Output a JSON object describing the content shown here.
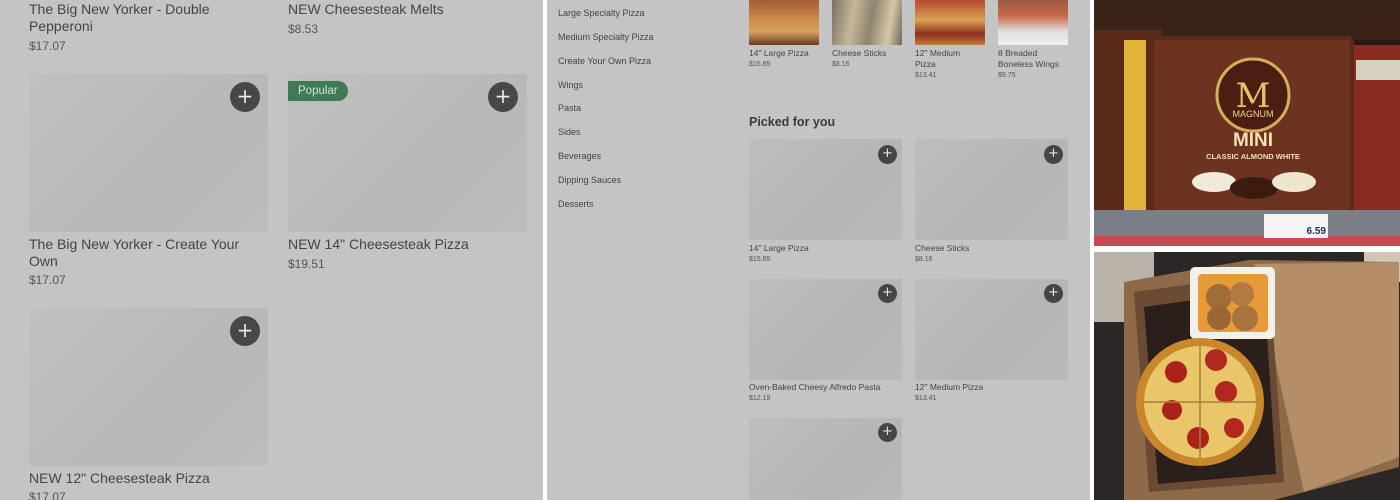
{
  "menu_left": {
    "items": [
      {
        "name": "The Big New Yorker - Double Pepperoni",
        "price": "$17.07"
      },
      {
        "name": "NEW Cheesesteak Melts",
        "price": "$8.53"
      },
      {
        "name": "The Big New Yorker - Create Your Own",
        "price": "$17.07"
      },
      {
        "name": "NEW 14\" Cheesesteak Pizza",
        "price": "$19.51",
        "badge": "Popular"
      },
      {
        "name": "NEW 12\" Cheesesteak Pizza",
        "price": "$17.07"
      }
    ],
    "add_glyph": "+"
  },
  "menu_right": {
    "categories": [
      "Large Specialty Pizza",
      "Medium Specialty Pizza",
      "Create Your Own Pizza",
      "Wings",
      "Pasta",
      "Sides",
      "Beverages",
      "Dipping Sauces",
      "Desserts"
    ],
    "top_items": [
      {
        "name": "14\" Large Pizza",
        "price": "$15.85"
      },
      {
        "name": "Cheese Sticks",
        "price": "$8.16"
      },
      {
        "name": "12\" Medium Pizza",
        "price": "$13.41"
      },
      {
        "name": "8 Breaded Boneless Wings",
        "price": "$9.75"
      }
    ],
    "section_title": "Picked for you",
    "picked": [
      {
        "name": "14\" Large Pizza",
        "price": "$15.85"
      },
      {
        "name": "Cheese Sticks",
        "price": "$8.16"
      },
      {
        "name": "Oven-Baked Cheesy Alfredo Pasta",
        "price": "$12.19"
      },
      {
        "name": "12\" Medium Pizza",
        "price": "$13.41"
      },
      {
        "name": "",
        "price": ""
      }
    ],
    "add_glyph": "+"
  },
  "photos": {
    "ice_cream": {
      "brand": "MAGNUM",
      "line": "MINI",
      "flavor": "CLASSIC ALMOND WHITE",
      "price_tag": "6.59"
    }
  }
}
